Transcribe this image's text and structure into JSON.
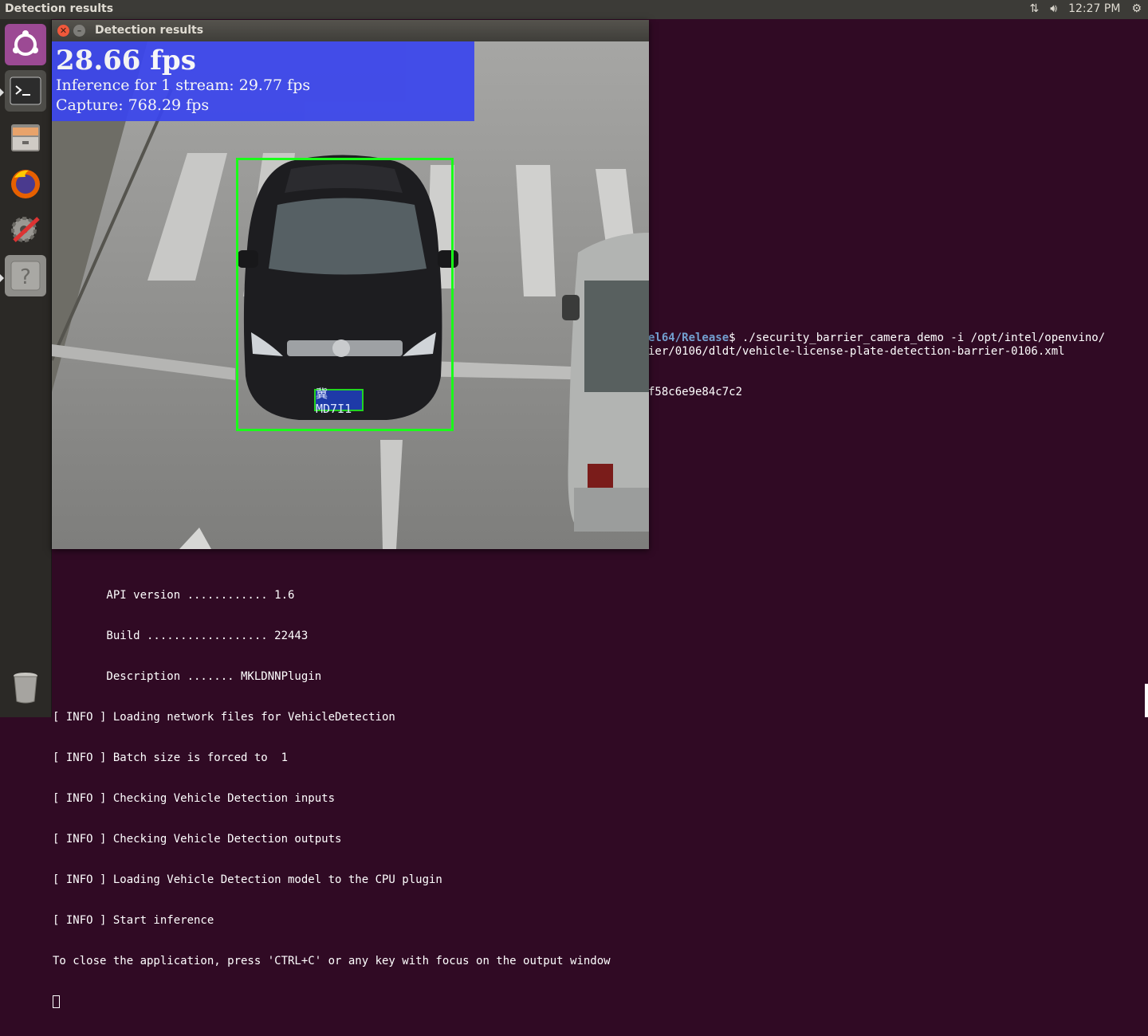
{
  "top_panel": {
    "title": "Detection results",
    "time": "12:27 PM",
    "icons": [
      "network-updown-icon",
      "volume-icon",
      "power-gear-icon"
    ]
  },
  "launcher": {
    "items": [
      "ubuntu-logo-icon",
      "terminal-icon",
      "files-icon",
      "firefox-icon",
      "settings-icon",
      "help-icon",
      "trash-icon"
    ]
  },
  "detection_window": {
    "title": "Detection results",
    "fps": "28.66 fps",
    "inference": "Inference for 1 stream: 29.77 fps",
    "capture": "Capture: 768.29 fps",
    "plate_text": "冀 MD7I1"
  },
  "terminal": {
    "path": "el64/Release",
    "command": "$ ./security_barrier_camera_demo -i /opt/intel/openvino/",
    "line2": "ier/0106/dldt/vehicle-license-plate-detection-barrier-0106.xml",
    "hash": "f58c6e9e84c7c2",
    "output": [
      "        API version ............ 1.6",
      "        Build .................. 22443",
      "        Description ....... MKLDNNPlugin",
      "[ INFO ] Loading network files for VehicleDetection",
      "[ INFO ] Batch size is forced to  1",
      "[ INFO ] Checking Vehicle Detection inputs",
      "[ INFO ] Checking Vehicle Detection outputs",
      "[ INFO ] Loading Vehicle Detection model to the CPU plugin",
      "[ INFO ] Start inference",
      "To close the application, press 'CTRL+C' or any key with focus on the output window"
    ]
  }
}
